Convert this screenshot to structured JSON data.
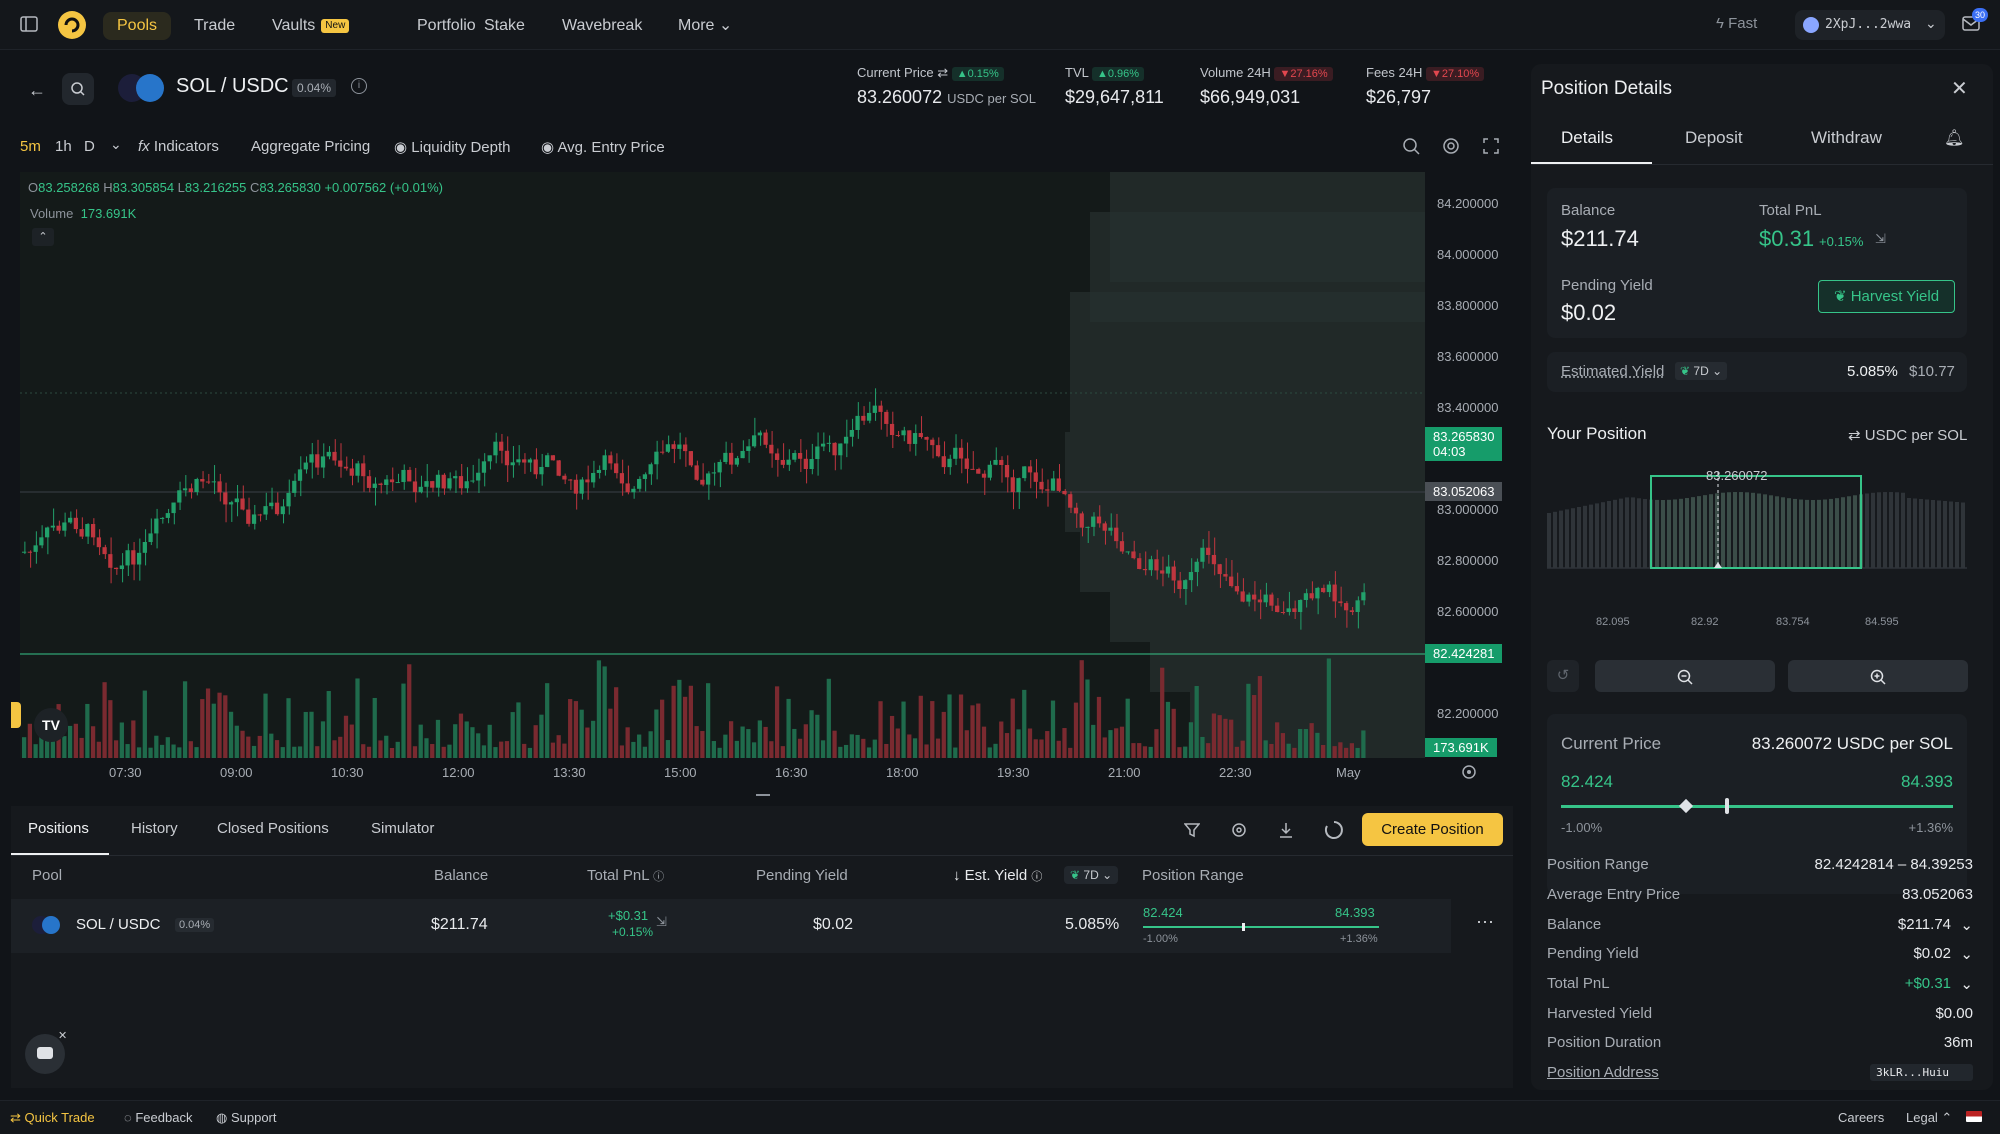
{
  "nav": {
    "items": [
      "Pools",
      "Trade",
      "Vaults",
      "Portfolio",
      "Stake",
      "Wavebreak",
      "More"
    ],
    "new_badge": "New",
    "fast": "Fast",
    "wallet": "2XpJ...2wwa",
    "notif_count": "30"
  },
  "pair": {
    "name": "SOL / USDC",
    "fee": "0.04%"
  },
  "stats": {
    "current_price_label": "Current Price",
    "current_price_change": "▲0.15%",
    "current_price_value": "83.260072",
    "current_price_unit": "USDC per SOL",
    "tvl_label": "TVL",
    "tvl_change": "▲0.96%",
    "tvl_value": "$29,647,811",
    "volume_label": "Volume 24H",
    "volume_change": "▼27.16%",
    "volume_value": "$66,949,031",
    "fees_label": "Fees 24H",
    "fees_change": "▼27.10%",
    "fees_value": "$26,797"
  },
  "toolbar": {
    "tf_5m": "5m",
    "tf_1h": "1h",
    "tf_d": "D",
    "indicators": "Indicators",
    "aggregate": "Aggregate Pricing",
    "liquidity": "Liquidity Depth",
    "avg_entry": "Avg. Entry Price"
  },
  "ohlc": {
    "o_label": "O",
    "o": "83.258268",
    "h_label": "H",
    "h": "83.305854",
    "l_label": "L",
    "l": "83.216255",
    "c_label": "C",
    "c": "83.265830",
    "change": "+0.007562 (+0.01%)",
    "volume_label": "Volume",
    "volume": "173.691K"
  },
  "chart_data": {
    "type": "candlestick",
    "y_ticks": [
      "84.200000",
      "84.000000",
      "83.800000",
      "83.600000",
      "83.400000",
      "83.000000",
      "82.800000",
      "82.600000",
      "82.200000"
    ],
    "x_ticks": [
      "07:30",
      "09:00",
      "10:30",
      "12:00",
      "13:30",
      "15:00",
      "16:30",
      "18:00",
      "19:30",
      "21:00",
      "22:30",
      "May"
    ],
    "last_price": "83.265830",
    "countdown": "04:03",
    "avg_entry": "83.052063",
    "range_low": "82.424281",
    "volume_last": "173.691K",
    "ylim": [
      82.0,
      84.3
    ]
  },
  "bottom": {
    "tabs": [
      "Positions",
      "History",
      "Closed Positions",
      "Simulator"
    ],
    "create": "Create Position",
    "headers": {
      "pool": "Pool",
      "balance": "Balance",
      "pnl": "Total PnL",
      "pending": "Pending Yield",
      "est": "Est. Yield",
      "period": "7D",
      "range": "Position Range"
    },
    "row": {
      "pool": "SOL / USDC",
      "fee": "0.04%",
      "balance": "$211.74",
      "pnl": "+$0.31",
      "pnl_pct": "+0.15%",
      "pending": "$0.02",
      "est": "5.085%",
      "range_low": "82.424",
      "range_high": "84.393",
      "low_pct": "-1.00%",
      "high_pct": "+1.36%"
    }
  },
  "panel": {
    "title": "Position Details",
    "tabs": [
      "Details",
      "Deposit",
      "Withdraw"
    ],
    "balance_label": "Balance",
    "balance": "$211.74",
    "pnl_label": "Total PnL",
    "pnl": "$0.31",
    "pnl_pct": "+0.15%",
    "pending_label": "Pending Yield",
    "pending": "$0.02",
    "harvest": "Harvest Yield",
    "est_label": "Estimated Yield",
    "est_period": "7D",
    "est_pct": "5.085%",
    "est_usd": "$10.77",
    "your_position": "Your Position",
    "unit_toggle": "USDC per SOL",
    "hist_price": "83.260072",
    "hist_ticks": [
      "82.095",
      "82.92",
      "83.754",
      "84.595"
    ],
    "cp_label": "Current Price",
    "cp_value": "83.260072 USDC per SOL",
    "range_low": "82.424",
    "range_high": "84.393",
    "low_pct": "-1.00%",
    "high_pct": "+1.36%",
    "details": [
      {
        "label": "Position Range",
        "value": "82.4242814 – 84.39253"
      },
      {
        "label": "Average Entry Price",
        "value": "83.052063"
      },
      {
        "label": "Balance",
        "value": "$211.74"
      },
      {
        "label": "Pending Yield",
        "value": "$0.02"
      },
      {
        "label": "Total PnL",
        "value": "+$0.31"
      },
      {
        "label": "Harvested Yield",
        "value": "$0.00"
      },
      {
        "label": "Position Duration",
        "value": "36m"
      },
      {
        "label": "Position Address",
        "value": "3kLR...Huiu"
      }
    ]
  },
  "footer": {
    "quick_trade": "Quick Trade",
    "feedback": "Feedback",
    "support": "Support",
    "careers": "Careers",
    "legal": "Legal"
  }
}
